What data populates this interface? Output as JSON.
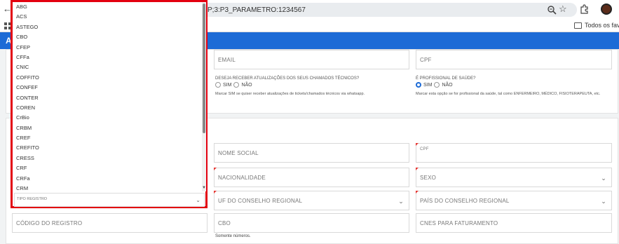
{
  "browser": {
    "url": "P;3:P3_PARAMETRO:1234567",
    "bookmarks_folder": "Todos os favorit",
    "back": "←",
    "star": "☆"
  },
  "header": {
    "title": "A"
  },
  "top_section": {
    "email_label": "EMAIL",
    "cpf_label": "CPF",
    "updates_question": "DESEJA RECEBER ATUALIZAÇÕES DOS SEUS CHAMADOS TÉCNICOS?",
    "updates_yes": "SIM",
    "updates_no": "NÃO",
    "updates_hint": "Marcar SIM se quiser receber atualizações de tickets/chamados técnicos via whatsapp.",
    "health_question": "É PROFISSIONAL DE SAÚDE?",
    "health_yes": "SIM",
    "health_no": "NÃO",
    "health_hint": "Marcar esta opção se for profissional da saúde, tal como ENFERMEIRO, MÉDICO, FISIOTERAPEUTA, etc."
  },
  "form": {
    "social_name": "NOME SOCIAL",
    "cpf_small": "CPF",
    "nationality": "NACIONALIDADE",
    "sex": "SEXO",
    "council_uf": "UF DO CONSELHO REGIONAL",
    "council_country": "PAÍS DO CONSELHO REGIONAL",
    "registry_code": "CÓDIGO DO REGISTRO",
    "cbo": "CBO",
    "cnes": "CNES PARA FATURAMENTO",
    "numbers_only": "Somente números."
  },
  "dropdown": {
    "select_label": "TIPO REGISTRO",
    "options": [
      "ABG",
      "ACS",
      "ASTEGO",
      "CBO",
      "CFEP",
      "CFFa",
      "CNIC",
      "COFFITO",
      "CONFEF",
      "CONTER",
      "COREN",
      "CrBio",
      "CRBM",
      "CREF",
      "CREFITO",
      "CRESS",
      "CRF",
      "CRFa",
      "CRM"
    ]
  },
  "colors": {
    "accent": "#1d6bd6",
    "highlight": "#e3000f"
  }
}
